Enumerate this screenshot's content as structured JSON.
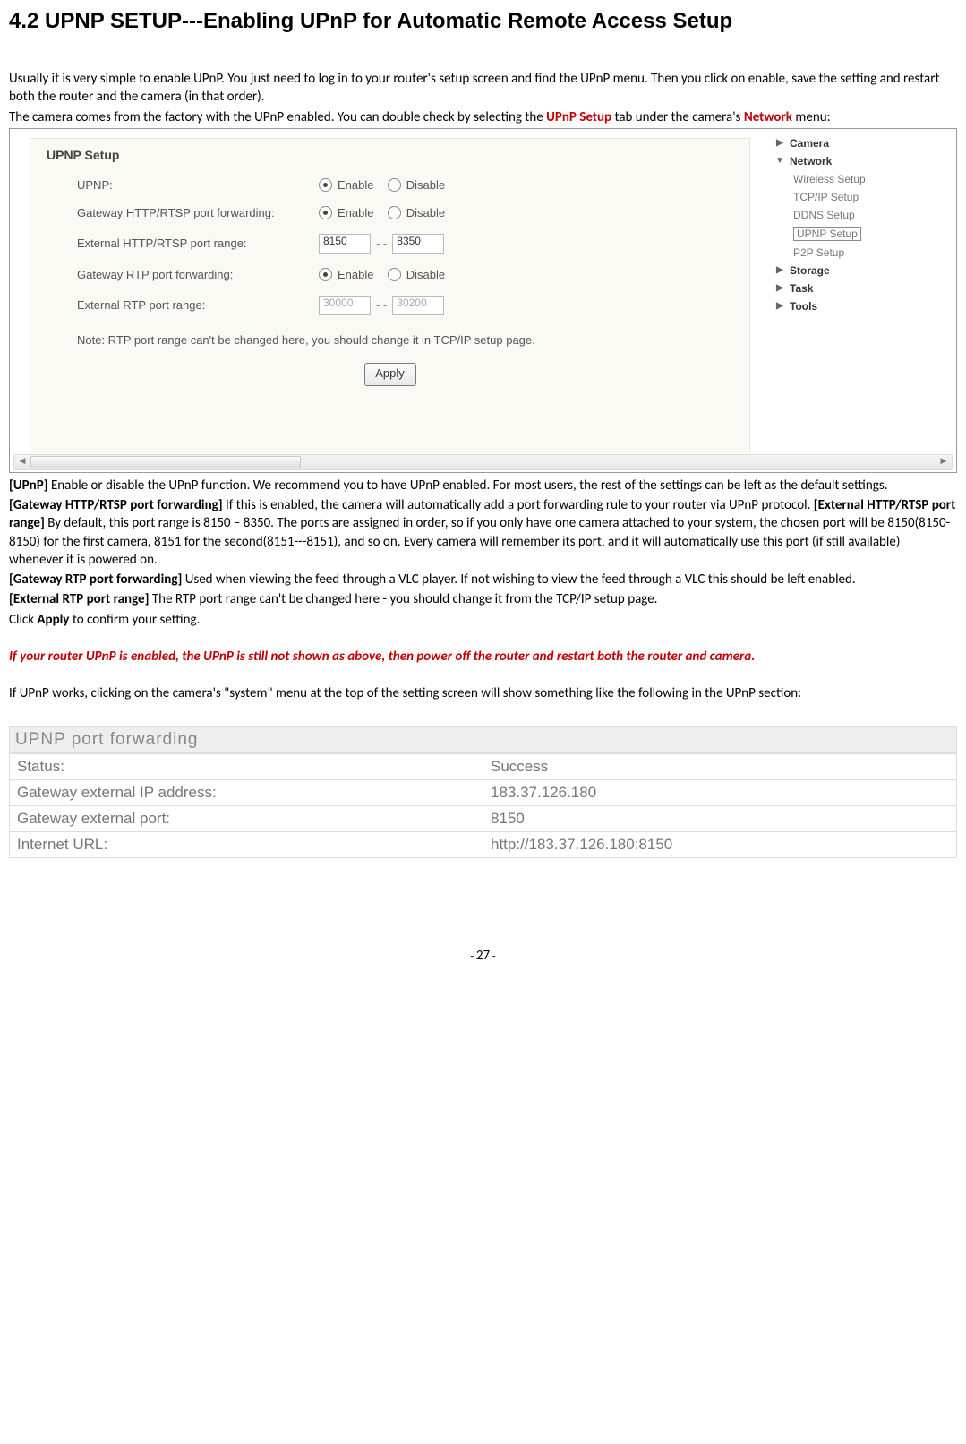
{
  "heading": "4.2 UPNP SETUP---Enabling UPnP for Automatic Remote Access Setup",
  "paras": {
    "p1": "Usually it is very simple to enable UPnP. You just need to log in to your router's setup screen and find the UPnP menu. Then you click on enable, save the setting and restart both the router and the camera (in that order).",
    "p2_pre": "The camera comes from the factory with the UPnP enabled. You can double check by selecting the ",
    "p2_red1": "UPnP Setup",
    "p2_mid": " tab under the camera's ",
    "p2_red2": "Network",
    "p2_post": " menu:"
  },
  "panel": {
    "title": "UPNP Setup",
    "rows": {
      "upnp": {
        "label": "UPNP:",
        "opt1": "Enable",
        "opt2": "Disable"
      },
      "gwhttp": {
        "label": "Gateway HTTP/RTSP port forwarding:",
        "opt1": "Enable",
        "opt2": "Disable"
      },
      "exthttp": {
        "label": "External HTTP/RTSP port range:",
        "v1": "8150",
        "v2": "8350"
      },
      "gwrtp": {
        "label": "Gateway RTP port forwarding:",
        "opt1": "Enable",
        "opt2": "Disable"
      },
      "extrtp": {
        "label": "External RTP port range:",
        "v1": "30000",
        "v2": "30200"
      }
    },
    "note": "Note: RTP port range can't be changed here, you should change it in TCP/IP setup page.",
    "apply": "Apply"
  },
  "sidemenu": {
    "camera": "Camera",
    "network": "Network",
    "items": [
      "Wireless Setup",
      "TCP/IP Setup",
      "DDNS Setup",
      "UPNP Setup",
      "P2P Setup"
    ],
    "storage": "Storage",
    "task": "Task",
    "tools": "Tools"
  },
  "body": {
    "b1_bold": "[UPnP]",
    "b1_rest": " Enable or disable the UPnP function. We recommend you to have UPnP enabled. For most users, the rest of the settings can be left as the default settings.",
    "b2_bold": "[Gateway HTTP/RTSP port forwarding]",
    "b2_mid": " If this is enabled, the camera will automatically add a port forwarding rule to your router via UPnP protocol. ",
    "b2_bold2": "[External HTTP/RTSP port range]",
    "b2_rest": " By default, this port range is 8150 – 8350. The ports are assigned in order, so if you only have one camera attached to your system, the chosen port will be 8150(8150-8150) for the first camera, 8151 for the second(8151---8151), and so on. Every camera will remember its port, and it will automatically use this port (if still available) whenever it is powered on.",
    "b3_bold": "[Gateway RTP port forwarding]",
    "b3_rest": " Used when viewing the feed through a VLC player. If not wishing to view the feed through a VLC this should be left enabled.",
    "b4_bold": "[External RTP port range]",
    "b4_rest": " The RTP port range can't be changed here - you should change it from the TCP/IP setup page.",
    "b5_pre": "Click ",
    "b5_bold": "Apply",
    "b5_post": " to confirm your setting.",
    "warn": "If your router UPnP is enabled, the UPnP is still not shown as above, then power off the router and restart both the router and camera.",
    "b6": "If UPnP works, clicking on the camera's \"system\" menu at the top of the setting screen will show something like the following in the UPnP section:"
  },
  "status": {
    "caption": "UPNP port forwarding",
    "rows": [
      {
        "k": "Status:",
        "v": "Success"
      },
      {
        "k": "Gateway external IP address:",
        "v": "183.37.126.180"
      },
      {
        "k": "Gateway external port:",
        "v": "8150"
      },
      {
        "k": "Internet URL:",
        "v": "http://183.37.126.180:8150"
      }
    ]
  },
  "pageno": "27"
}
